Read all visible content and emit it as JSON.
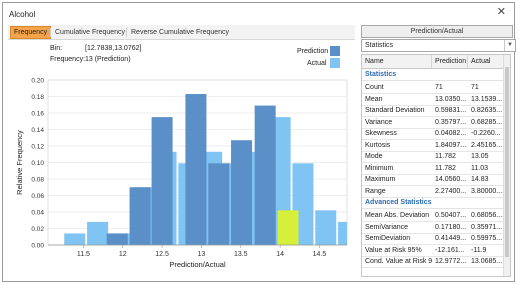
{
  "window": {
    "title": "Alcohol",
    "close_glyph": "✕"
  },
  "tabs": [
    {
      "label": "Frequency",
      "active": true
    },
    {
      "label": "Cumulative Frequency",
      "active": false
    },
    {
      "label": "Reverse Cumulative Frequency",
      "active": false
    }
  ],
  "bin_info": {
    "bin_label": "Bin:",
    "bin_value": "[12.7838,13.0762]",
    "freq_label": "Frequency:",
    "freq_value": "13 (Prediction)"
  },
  "legend": {
    "prediction": {
      "label": "Prediction",
      "color": "#5b8fc7"
    },
    "actual": {
      "label": "Actual",
      "color": "#7fc4f2"
    }
  },
  "highlight_color": "#d5ef3a",
  "chart_data": {
    "type": "bar",
    "xlabel": "Prediction/Actual",
    "ylabel": "Relative Frequency",
    "ylim": [
      0,
      0.2
    ],
    "yticks": [
      "0.00",
      "0.02",
      "0.04",
      "0.06",
      "0.08",
      "0.10",
      "0.12",
      "0.14",
      "0.16",
      "0.18",
      "0.20"
    ],
    "xticks": [
      {
        "label": "11.5",
        "value": 11.5
      },
      {
        "label": "12",
        "value": 12.0
      },
      {
        "label": "12.5",
        "value": 12.5
      },
      {
        "label": "13",
        "value": 13.0
      },
      {
        "label": "13.5",
        "value": 13.5
      },
      {
        "label": "14",
        "value": 14.0
      },
      {
        "label": "14.5",
        "value": 14.5
      }
    ],
    "xlim": [
      11.05,
      14.85
    ],
    "bin_width": 0.2924,
    "highlight_bin_index": 7,
    "series": [
      {
        "name": "Prediction",
        "bins": [
          {
            "x": 11.93,
            "value": 0.014
          },
          {
            "x": 12.22,
            "value": 0.07
          },
          {
            "x": 12.5,
            "value": 0.155
          },
          {
            "x": 12.93,
            "value": 0.183
          },
          {
            "x": 13.22,
            "value": 0.099
          },
          {
            "x": 13.51,
            "value": 0.127
          },
          {
            "x": 13.81,
            "value": 0.169
          },
          {
            "x": 14.1,
            "value": 0.042
          }
        ]
      },
      {
        "name": "Actual",
        "bins": [
          {
            "x": 11.39,
            "value": 0.014
          },
          {
            "x": 11.68,
            "value": 0.028
          },
          {
            "x": 11.97,
            "value": 0.014
          },
          {
            "x": 12.26,
            "value": 0.07
          },
          {
            "x": 12.55,
            "value": 0.113
          },
          {
            "x": 12.84,
            "value": 0.099
          },
          {
            "x": 13.13,
            "value": 0.113
          },
          {
            "x": 13.42,
            "value": 0.099
          },
          {
            "x": 13.71,
            "value": 0.113
          },
          {
            "x": 14.0,
            "value": 0.155
          },
          {
            "x": 14.29,
            "value": 0.099
          },
          {
            "x": 14.58,
            "value": 0.042
          },
          {
            "x": 14.87,
            "value": 0.028
          }
        ]
      }
    ]
  },
  "right_panel": {
    "button_label": "Prediction/Actual",
    "select_value": "Statistics",
    "headers": [
      "Name",
      "Prediction",
      "Actual"
    ],
    "sections": [
      {
        "title": "Statistics",
        "rows": [
          [
            "Count",
            "71",
            "71"
          ],
          [
            "Mean",
            "13.0350...",
            "13.1539..."
          ],
          [
            "Standard Deviation",
            "0.59831...",
            "0.82635..."
          ],
          [
            "Variance",
            "0.35797...",
            "0.68285..."
          ],
          [
            "Skewness",
            "0.04082...",
            "-0.2260..."
          ],
          [
            "Kurtosis",
            "1.84097...",
            "2.45165..."
          ],
          [
            "Mode",
            "11.782",
            "13.05"
          ],
          [
            "Minimum",
            "11.782",
            "11.03"
          ],
          [
            "Maximum",
            "14.0560...",
            "14.83"
          ],
          [
            "Range",
            "2.27400...",
            "3.80000..."
          ]
        ]
      },
      {
        "title": "Advanced Statistics",
        "rows": [
          [
            "Mean Abs. Deviation",
            "0.50407...",
            "0.68056..."
          ],
          [
            "SemiVariance",
            "0.17180...",
            "0.35971..."
          ],
          [
            "SemiDeviation",
            "0.41449...",
            "0.59975..."
          ],
          [
            "Value at Risk 95%",
            "-12.161...",
            "-11.9"
          ],
          [
            "Cond. Value at Risk 9...",
            "12.9772...",
            "13.0685..."
          ]
        ]
      }
    ]
  }
}
